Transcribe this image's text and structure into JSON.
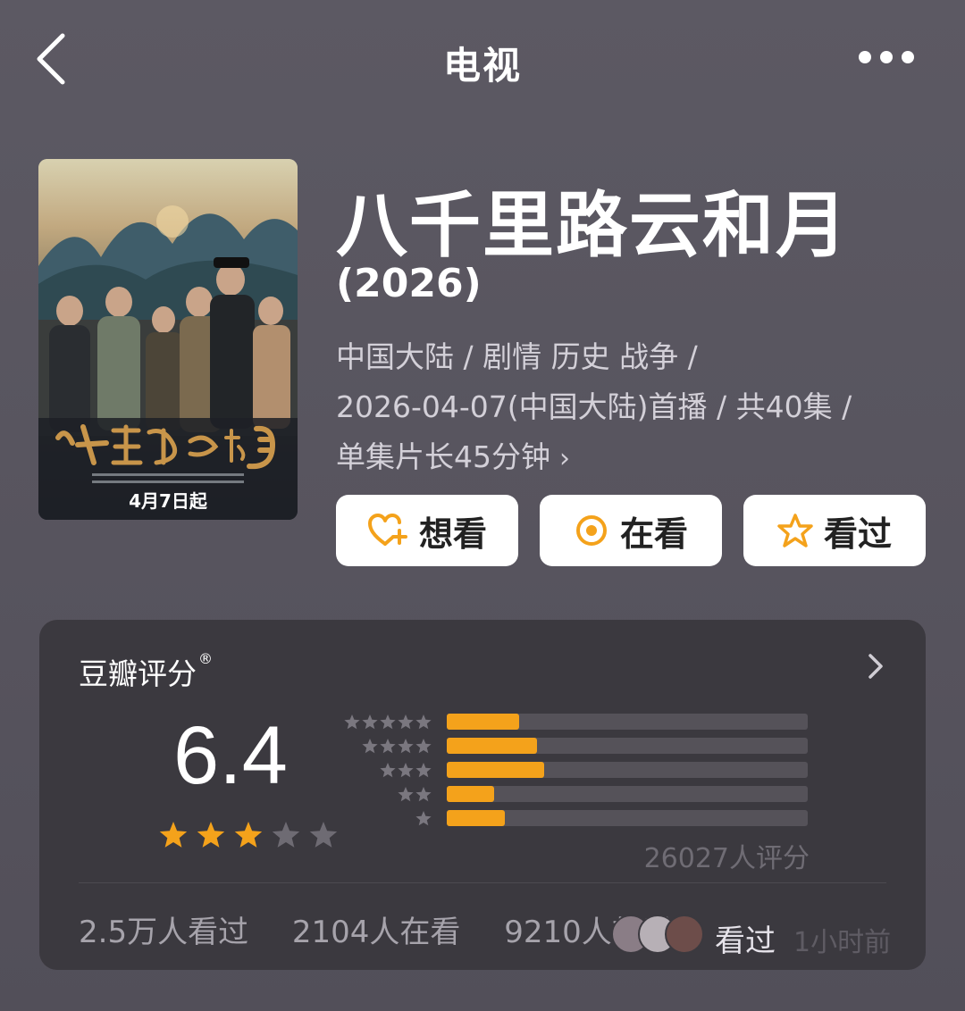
{
  "nav": {
    "title": "电视",
    "back_icon": "chevron-left-icon",
    "more_icon": "more-horizontal-icon"
  },
  "poster": {
    "date_text": "4月7日起",
    "calligraphy_title": "八千里路云和月"
  },
  "show": {
    "title": "八千里路云和月",
    "year": "(2026)",
    "meta_line1": "中国大陆 / 剧情 历史 战争 /",
    "meta_line2": "2026-04-07(中国大陆)首播 / 共40集 /",
    "meta_line3": "单集片长45分钟",
    "meta_chevron": "›"
  },
  "actions": [
    {
      "label": "想看",
      "icon": "heart-plus-icon"
    },
    {
      "label": "在看",
      "icon": "target-icon"
    },
    {
      "label": "看过",
      "icon": "star-outline-icon"
    }
  ],
  "colors": {
    "accent": "#f4a21b",
    "card_bg": "#3b393f",
    "page_bg": "#5a5761"
  },
  "rating": {
    "title": "豆瓣评分",
    "registered_mark": "®",
    "score": "6.4",
    "stars_filled": 3,
    "stars_total": 5,
    "count_text": "26027人评分",
    "distribution": [
      {
        "stars": 5,
        "fraction": 0.2
      },
      {
        "stars": 4,
        "fraction": 0.25
      },
      {
        "stars": 3,
        "fraction": 0.27
      },
      {
        "stars": 2,
        "fraction": 0.13
      },
      {
        "stars": 1,
        "fraction": 0.16
      }
    ]
  },
  "stats": {
    "watched": "2.5万人看过",
    "watching": "2104人在看",
    "want": "9210人想看"
  },
  "friends": {
    "action": "看过",
    "time": "1小时前"
  }
}
